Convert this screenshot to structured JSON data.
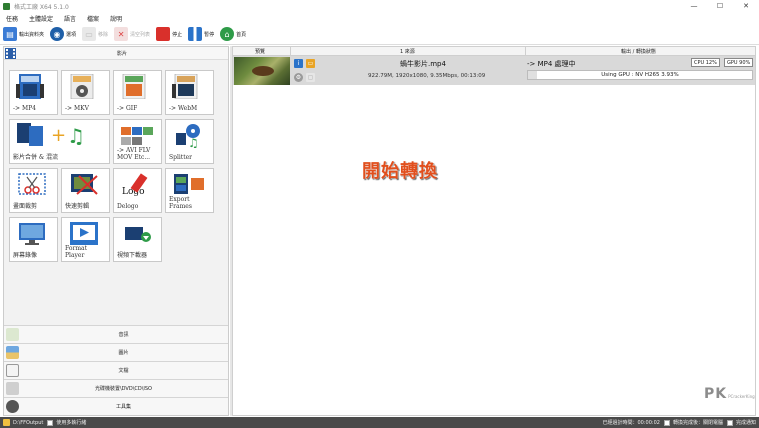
{
  "window": {
    "title": "格式工廠 X64 5.1.0",
    "minimize": "—",
    "maximize": "☐",
    "close": "✕"
  },
  "menu": [
    "任務",
    "主體設定",
    "語言",
    "檔案",
    "說明"
  ],
  "toolbar": {
    "output_folder": "輸出資料夾",
    "options": "選項",
    "remove": "移除",
    "clear_list": "清空列表",
    "stop": "停止",
    "start": "暫停",
    "home": "首頁"
  },
  "left_panel": {
    "video_category": "影片",
    "tools": [
      {
        "label": "-> MP4",
        "badge": "MP4"
      },
      {
        "label": "-> MKV",
        "badge": "MKV"
      },
      {
        "label": "-> GIF",
        "badge": "GIF"
      },
      {
        "label": "-> WebM",
        "badge": "WebM"
      },
      {
        "label": "影片合併 & 混流",
        "badge": ""
      },
      {
        "label": "-> AVI FLV\nMOV Etc...",
        "badge": "AVI"
      },
      {
        "label": "Splitter",
        "badge": ""
      },
      {
        "label": "畫面裁剪",
        "badge": ""
      },
      {
        "label": "快速剪輯",
        "badge": ""
      },
      {
        "label": "Delogo",
        "badge": "Logo"
      },
      {
        "label": "Export Frames",
        "badge": ""
      },
      {
        "label": "屏幕錄像",
        "badge": ""
      },
      {
        "label": "Format Player",
        "badge": ""
      },
      {
        "label": "視頻下載器",
        "badge": ""
      }
    ],
    "bottom_categories": [
      "音訊",
      "圖片",
      "文檔",
      "光碟機裝置\\DVD\\CD\\ISO",
      "工具集"
    ]
  },
  "task_list": {
    "columns": {
      "preview": "預覽",
      "source": "1 來源",
      "output": "輸出 / 轉換狀態"
    },
    "rows": [
      {
        "filename": "蝸牛影片.mp4",
        "meta": "922.79M, 1920x1080, 9.35Mbps, 00:13:09",
        "status": "-> MP4 處理中",
        "cpu": "CPU 12%",
        "gpu": "GPU 90%",
        "progress_text": "Using GPU : NV H265 3.93%",
        "progress": 3.93
      }
    ]
  },
  "overlay": "開始轉換",
  "watermark": {
    "logo": "PK",
    "sub": "PCrackerKing"
  },
  "statusbar": {
    "output_path": "D:\\FFOutput",
    "multithread": "使用多執行緒",
    "elapsed": "已經過計時間：00:00:02",
    "shutdown": "轉換完成後：關閉電腦",
    "notify": "完成通知"
  },
  "colors": {
    "accent_red": "#d9302b",
    "accent_blue": "#2b73c9",
    "overlay_orange": "#e14f1d"
  }
}
